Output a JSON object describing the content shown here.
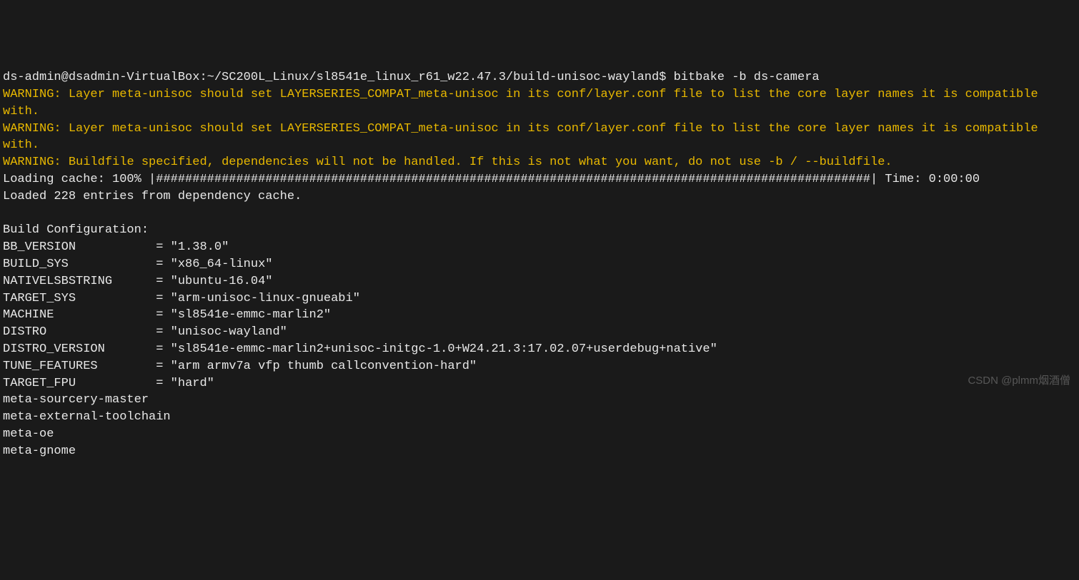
{
  "prompt": {
    "user_host": "ds-admin@dsadmin-VirtualBox",
    "path": "~/SC200L_Linux/sl8541e_linux_r61_w22.47.3/build-unisoc-wayland",
    "symbol": "$",
    "command": "bitbake -b ds-camera"
  },
  "warnings": [
    {
      "tag": "WARNING:",
      "text": "Layer meta-unisoc should set LAYERSERIES_COMPAT_meta-unisoc in its conf/layer.conf file to list the core layer names it is compatible with."
    },
    {
      "tag": "WARNING:",
      "text": "Layer meta-unisoc should set LAYERSERIES_COMPAT_meta-unisoc in its conf/layer.conf file to list the core layer names it is compatible with."
    },
    {
      "tag": "WARNING:",
      "text": "Buildfile specified, dependencies will not be handled. If this is not what you want, do not use -b / --buildfile."
    }
  ],
  "loading": {
    "prefix": "Loading cache: 100% |",
    "bar": "##################################################################################################",
    "suffix": "| Time: 0:00:00"
  },
  "loaded_line": "Loaded 228 entries from dependency cache.",
  "build_config_header": "Build Configuration:",
  "config": [
    {
      "key": "BB_VERSION",
      "val": "\"1.38.0\""
    },
    {
      "key": "BUILD_SYS",
      "val": "\"x86_64-linux\""
    },
    {
      "key": "NATIVELSBSTRING",
      "val": "\"ubuntu-16.04\""
    },
    {
      "key": "TARGET_SYS",
      "val": "\"arm-unisoc-linux-gnueabi\""
    },
    {
      "key": "MACHINE",
      "val": "\"sl8541e-emmc-marlin2\""
    },
    {
      "key": "DISTRO",
      "val": "\"unisoc-wayland\""
    },
    {
      "key": "DISTRO_VERSION",
      "val": "\"sl8541e-emmc-marlin2+unisoc-initgc-1.0+W24.21.3:17.02.07+userdebug+native\""
    },
    {
      "key": "TUNE_FEATURES",
      "val": "\"arm armv7a vfp thumb callconvention-hard\""
    },
    {
      "key": "TARGET_FPU",
      "val": "\"hard\""
    }
  ],
  "meta_layers": [
    "meta-sourcery-master",
    "meta-external-toolchain",
    "meta-oe",
    "meta-gnome"
  ],
  "watermark": "CSDN @plmm烟酒僧"
}
